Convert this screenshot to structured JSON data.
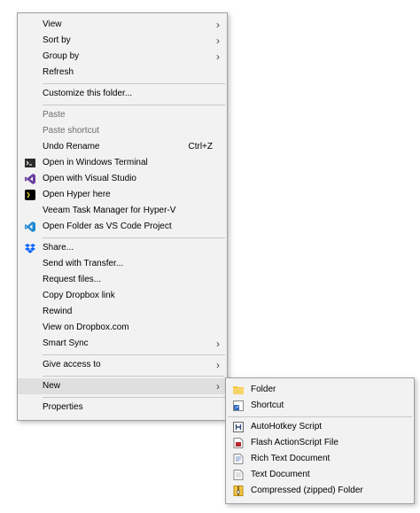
{
  "main_menu": {
    "view": "View",
    "sort_by": "Sort by",
    "group_by": "Group by",
    "refresh": "Refresh",
    "customize": "Customize this folder...",
    "paste": "Paste",
    "paste_shortcut": "Paste shortcut",
    "undo_rename": "Undo Rename",
    "undo_shortcut": "Ctrl+Z",
    "open_terminal": "Open in Windows Terminal",
    "open_vs": "Open with Visual Studio",
    "open_hyper": "Open Hyper here",
    "veeam": "Veeam Task Manager for Hyper-V",
    "open_vscode": "Open Folder as VS Code Project",
    "share": "Share...",
    "send_transfer": "Send with Transfer...",
    "request_files": "Request files...",
    "copy_dropbox": "Copy Dropbox link",
    "rewind": "Rewind",
    "view_dropbox": "View on Dropbox.com",
    "smart_sync": "Smart Sync",
    "give_access": "Give access to",
    "new": "New",
    "properties": "Properties"
  },
  "submenu": {
    "folder": "Folder",
    "shortcut": "Shortcut",
    "ahk": "AutoHotkey Script",
    "flash": "Flash ActionScript File",
    "rtf": "Rich Text Document",
    "txt": "Text Document",
    "zip": "Compressed (zipped) Folder"
  },
  "arrow_glyph": "›",
  "colors": {
    "menu_bg": "#f2f2f2",
    "highlight": "#dfdfdf",
    "disabled_text": "#6d6d6d",
    "vs_purple": "#6a3fa0",
    "vscode_blue": "#1f8ad2",
    "dropbox_blue": "#0061fe",
    "folder_yellow": "#f4c542"
  },
  "icons": [
    "terminal-icon",
    "visual-studio-icon",
    "hyper-icon",
    "vscode-icon",
    "dropbox-icon",
    "folder-icon",
    "shortcut-icon",
    "autohotkey-icon",
    "flash-icon",
    "rtf-icon",
    "text-document-icon",
    "zip-icon"
  ]
}
